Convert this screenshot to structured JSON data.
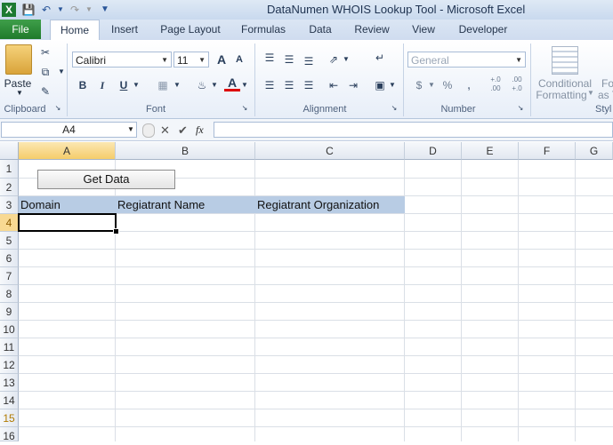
{
  "window": {
    "title": "DataNumen WHOIS Lookup Tool  -  Microsoft Excel"
  },
  "tabs": [
    "File",
    "Home",
    "Insert",
    "Page Layout",
    "Formulas",
    "Data",
    "Review",
    "View",
    "Developer"
  ],
  "ribbon": {
    "clipboard": {
      "paste": "Paste",
      "label": "Clipboard"
    },
    "font": {
      "name": "Calibri",
      "size": "11",
      "bold": "B",
      "italic": "I",
      "underline": "U",
      "grow": "A",
      "shrink": "A",
      "color": "A",
      "label": "Font"
    },
    "alignment": {
      "label": "Alignment"
    },
    "number": {
      "format": "General",
      "currency": "$",
      "percent": "%",
      "comma": ",",
      "inc_dec": "+.0 .00",
      "dec_dec": ".00 +.0",
      "label": "Number"
    },
    "styles": {
      "conditional": "Conditional",
      "formatting": "Formatting",
      "fo": "Fo",
      "as": "as T",
      "label": "Styl"
    }
  },
  "formula_bar": {
    "name_box": "A4",
    "cancel": "✕",
    "enter": "✔",
    "fx": "fx",
    "value": ""
  },
  "sheet": {
    "columns": [
      "A",
      "B",
      "C",
      "D",
      "E",
      "F",
      "G"
    ],
    "rows": [
      "1",
      "2",
      "3",
      "4",
      "5",
      "6",
      "7",
      "8",
      "9",
      "10",
      "11",
      "12",
      "13",
      "14",
      "15",
      "16"
    ],
    "button_label": "Get Data",
    "headers": [
      "Domain",
      "Regiatrant Name",
      "Regiatrant Organization"
    ],
    "selected_row": "4",
    "selected_col": "A"
  }
}
